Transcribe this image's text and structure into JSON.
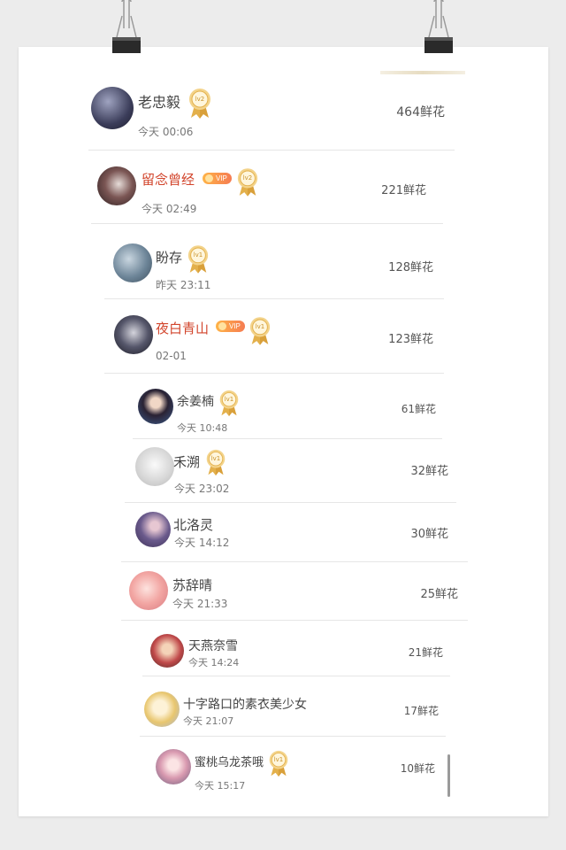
{
  "entries": [
    {
      "name": "老忠毅",
      "time": "今天 00:06",
      "flowers": "464鲜花",
      "medal": "lv2",
      "vip": false
    },
    {
      "name": "留念曾经",
      "time": "今天 02:49",
      "flowers": "221鲜花",
      "medal": "lv2",
      "vip": true
    },
    {
      "name": "盼存",
      "time": "昨天 23:11",
      "flowers": "128鲜花",
      "medal": "lv1",
      "vip": false
    },
    {
      "name": "夜白青山",
      "time": "02-01",
      "flowers": "123鲜花",
      "medal": "lv1",
      "vip": true
    },
    {
      "name": "余姜楠",
      "time": "今天 10:48",
      "flowers": "61鲜花",
      "medal": "lv1",
      "vip": false
    },
    {
      "name": "禾溯",
      "time": "今天 23:02",
      "flowers": "32鲜花",
      "medal": "lv1",
      "vip": false
    },
    {
      "name": "北洛灵",
      "time": "今天 14:12",
      "flowers": "30鲜花",
      "medal": "",
      "vip": false
    },
    {
      "name": "苏辞晴",
      "time": "今天 21:33",
      "flowers": "25鲜花",
      "medal": "",
      "vip": false
    },
    {
      "name": "天燕奈雪",
      "time": "今天 14:24",
      "flowers": "21鲜花",
      "medal": "",
      "vip": false
    },
    {
      "name": "十字路口的素衣美少女",
      "time": "今天 21:07",
      "flowers": "17鲜花",
      "medal": "",
      "vip": false
    },
    {
      "name": "蜜桃乌龙茶哦",
      "time": "今天 15:17",
      "flowers": "10鲜花",
      "medal": "lv1",
      "vip": false
    }
  ],
  "vip_label": "VIP",
  "colors": {
    "vip_name": "#d2452c",
    "medal": "#e3b04b",
    "background": "#ececec"
  },
  "icons": {
    "medal": "medal-icon",
    "vip": "vip-badge",
    "clip": "binder-clip-icon"
  }
}
